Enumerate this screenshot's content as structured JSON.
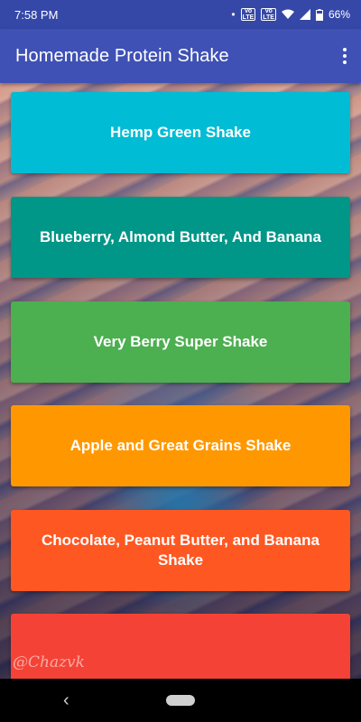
{
  "status_bar": {
    "time": "7:58 PM",
    "signal1_label": "Vo LTE",
    "signal2_label": "Vo LTE",
    "battery": "66%",
    "icons": [
      "dot-icon",
      "volte-icon",
      "volte-icon",
      "wifi-icon",
      "signal-icon",
      "battery-icon"
    ]
  },
  "app_bar": {
    "title": "Homemade Protein Shake",
    "menu_icon": "overflow-menu-icon"
  },
  "shakes": [
    {
      "label": "Hemp Green Shake",
      "color": "#00bcd4"
    },
    {
      "label": "Blueberry, Almond Butter, And Banana",
      "color": "#009688"
    },
    {
      "label": "Very Berry Super Shake",
      "color": "#4caf50"
    },
    {
      "label": "Apple and Great Grains Shake",
      "color": "#ff9800"
    },
    {
      "label": "Chocolate, Peanut Butter, and Banana Shake",
      "color": "#ff5722"
    },
    {
      "label": "",
      "color": "#f44336"
    }
  ],
  "background_signature": "@Chazvk",
  "nav_bar": {
    "back_icon": "back-icon",
    "home_icon": "home-pill-icon"
  }
}
